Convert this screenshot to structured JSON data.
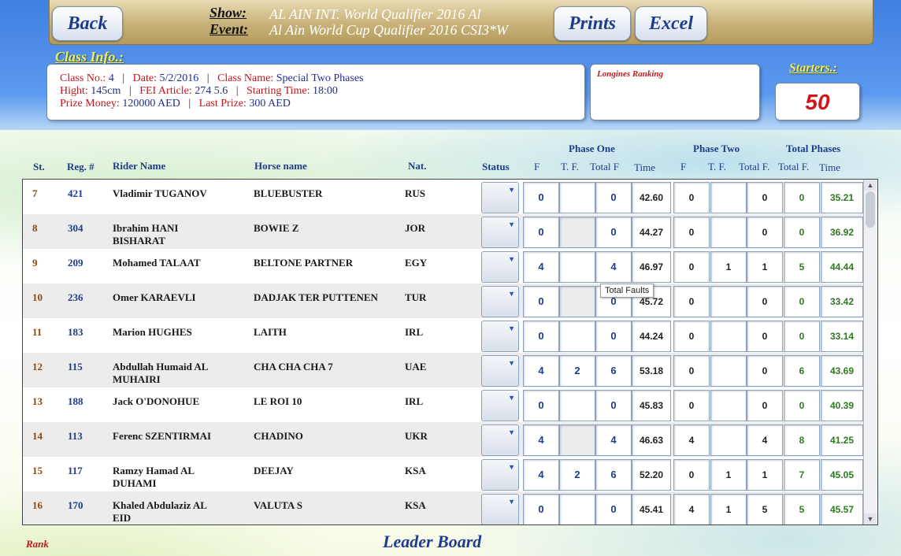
{
  "header": {
    "back_label": "Back",
    "show_label": "Show:",
    "show_value": "AL AIN INT. World Qualifier  2016  Al",
    "event_label": "Event:",
    "event_value": "Al Ain World Cup Qualifier 2016  CSI3*W",
    "prints_label": "Prints",
    "excel_label": "Excel"
  },
  "class_info": {
    "title": "Class Info.:",
    "line1": [
      {
        "t": "Class No.: ",
        "c": "r"
      },
      {
        "t": "4",
        "c": "b"
      },
      {
        "t": "   |   ",
        "c": "k"
      },
      {
        "t": "Date: ",
        "c": "r"
      },
      {
        "t": "5/2/2016",
        "c": "b"
      },
      {
        "t": "   |   ",
        "c": "k"
      },
      {
        "t": "Class Name: ",
        "c": "r"
      },
      {
        "t": "Special Two Phases",
        "c": "b"
      }
    ],
    "line2": [
      {
        "t": "Hight: ",
        "c": "r"
      },
      {
        "t": "145cm",
        "c": "b"
      },
      {
        "t": "   |   ",
        "c": "k"
      },
      {
        "t": "FEI Article: ",
        "c": "r"
      },
      {
        "t": "274 5.6",
        "c": "b"
      },
      {
        "t": "   |   ",
        "c": "k"
      },
      {
        "t": "Starting Time: ",
        "c": "r"
      },
      {
        "t": "18:00",
        "c": "b"
      }
    ],
    "line3": [
      {
        "t": "Prize Money: ",
        "c": "r"
      },
      {
        "t": "120000 AED",
        "c": "b"
      },
      {
        "t": "   |   ",
        "c": "k"
      },
      {
        "t": "Last Prize: ",
        "c": "r"
      },
      {
        "t": "300 AED",
        "c": "b"
      }
    ]
  },
  "ranking": {
    "label": "Longines Ranking"
  },
  "starters": {
    "title": "Starters.:",
    "value": "50"
  },
  "columns": {
    "st": "St.",
    "reg": "Reg. #",
    "rider": "Rider Name",
    "horse": "Horse  name",
    "nat": "Nat.",
    "status": "Status",
    "phase_one": "Phase One",
    "phase_two": "Phase Two",
    "total_phases": "Total Phases",
    "p1_f": "F",
    "p1_tf": "T. F.",
    "p1_total": "Total F",
    "p1_time": "Time",
    "p2_f": "F",
    "p2_tf": "T. F.",
    "p2_total": "Total F.",
    "tot_f": "Total F.",
    "tot_time": "Time"
  },
  "rows": [
    {
      "st": "7",
      "reg": "421",
      "rider": "Vladimir TUGANOV",
      "horse": "BLUEBUSTER",
      "nat": "RUS",
      "p1_f": "0",
      "p1_tf": "",
      "p1_total": "0",
      "p1_time": "42.60",
      "p2_f": "0",
      "p2_tf": "",
      "p2_total": "0",
      "tot_f": "0",
      "tot_time": "35.21"
    },
    {
      "st": "8",
      "reg": "304",
      "rider": "Ibrahim HANI\nBISHARAT",
      "horse": "BOWIE Z",
      "nat": "JOR",
      "p1_f": "0",
      "p1_tf": "",
      "p1_total": "0",
      "p1_time": "44.27",
      "p2_f": "0",
      "p2_tf": "",
      "p2_total": "0",
      "tot_f": "0",
      "tot_time": "36.92"
    },
    {
      "st": "9",
      "reg": "209",
      "rider": "Mohamed TALAAT",
      "horse": "BELTONE PARTNER",
      "nat": "EGY",
      "p1_f": "4",
      "p1_tf": "",
      "p1_total": "4",
      "p1_time": "46.97",
      "p2_f": "0",
      "p2_tf": "1",
      "p2_total": "1",
      "tot_f": "5",
      "tot_time": "44.44"
    },
    {
      "st": "10",
      "reg": "236",
      "rider": "Omer KARAEVLI",
      "horse": "DADJAK TER PUTTENEN",
      "nat": "TUR",
      "p1_f": "0",
      "p1_tf": "",
      "p1_total": "0",
      "p1_time": "45.72",
      "p2_f": "0",
      "p2_tf": "",
      "p2_total": "0",
      "tot_f": "0",
      "tot_time": "33.42"
    },
    {
      "st": "11",
      "reg": "183",
      "rider": "Marion HUGHES",
      "horse": "LAITH",
      "nat": "IRL",
      "p1_f": "0",
      "p1_tf": "",
      "p1_total": "0",
      "p1_time": "44.24",
      "p2_f": "0",
      "p2_tf": "",
      "p2_total": "0",
      "tot_f": "0",
      "tot_time": "33.14"
    },
    {
      "st": "12",
      "reg": "115",
      "rider": "Abdullah Humaid AL\nMUHAIRI",
      "horse": "CHA CHA CHA 7",
      "nat": "UAE",
      "p1_f": "4",
      "p1_tf": "2",
      "p1_total": "6",
      "p1_time": "53.18",
      "p2_f": "0",
      "p2_tf": "",
      "p2_total": "0",
      "tot_f": "6",
      "tot_time": "43.69"
    },
    {
      "st": "13",
      "reg": "188",
      "rider": "Jack O'DONOHUE",
      "horse": "LE ROI 10",
      "nat": "IRL",
      "p1_f": "0",
      "p1_tf": "",
      "p1_total": "0",
      "p1_time": "45.83",
      "p2_f": "0",
      "p2_tf": "",
      "p2_total": "0",
      "tot_f": "0",
      "tot_time": "40.39"
    },
    {
      "st": "14",
      "reg": "113",
      "rider": "Ferenc SZENTIRMAI",
      "horse": "CHADINO",
      "nat": "UKR",
      "p1_f": "4",
      "p1_tf": "",
      "p1_total": "4",
      "p1_time": "46.63",
      "p2_f": "4",
      "p2_tf": "",
      "p2_total": "4",
      "tot_f": "8",
      "tot_time": "41.25"
    },
    {
      "st": "15",
      "reg": "117",
      "rider": "Ramzy Hamad AL\nDUHAMI",
      "horse": "DEEJAY",
      "nat": "KSA",
      "p1_f": "4",
      "p1_tf": "2",
      "p1_total": "6",
      "p1_time": "52.20",
      "p2_f": "0",
      "p2_tf": "1",
      "p2_total": "1",
      "tot_f": "7",
      "tot_time": "45.05"
    },
    {
      "st": "16",
      "reg": "170",
      "rider": "Khaled Abdulaziz AL\nEID",
      "horse": "VALUTA S",
      "nat": "KSA",
      "p1_f": "0",
      "p1_tf": "",
      "p1_total": "0",
      "p1_time": "45.41",
      "p2_f": "4",
      "p2_tf": "1",
      "p2_total": "5",
      "tot_f": "5",
      "tot_time": "45.57"
    }
  ],
  "tooltip": "Total Faults",
  "footer": {
    "rank_label": "Rank",
    "title": "Leader Board"
  },
  "colors": {
    "accent_blue": "#1f3b8c",
    "red": "#c4161c",
    "green": "#2f7a20",
    "gold": "#c9b47c"
  }
}
